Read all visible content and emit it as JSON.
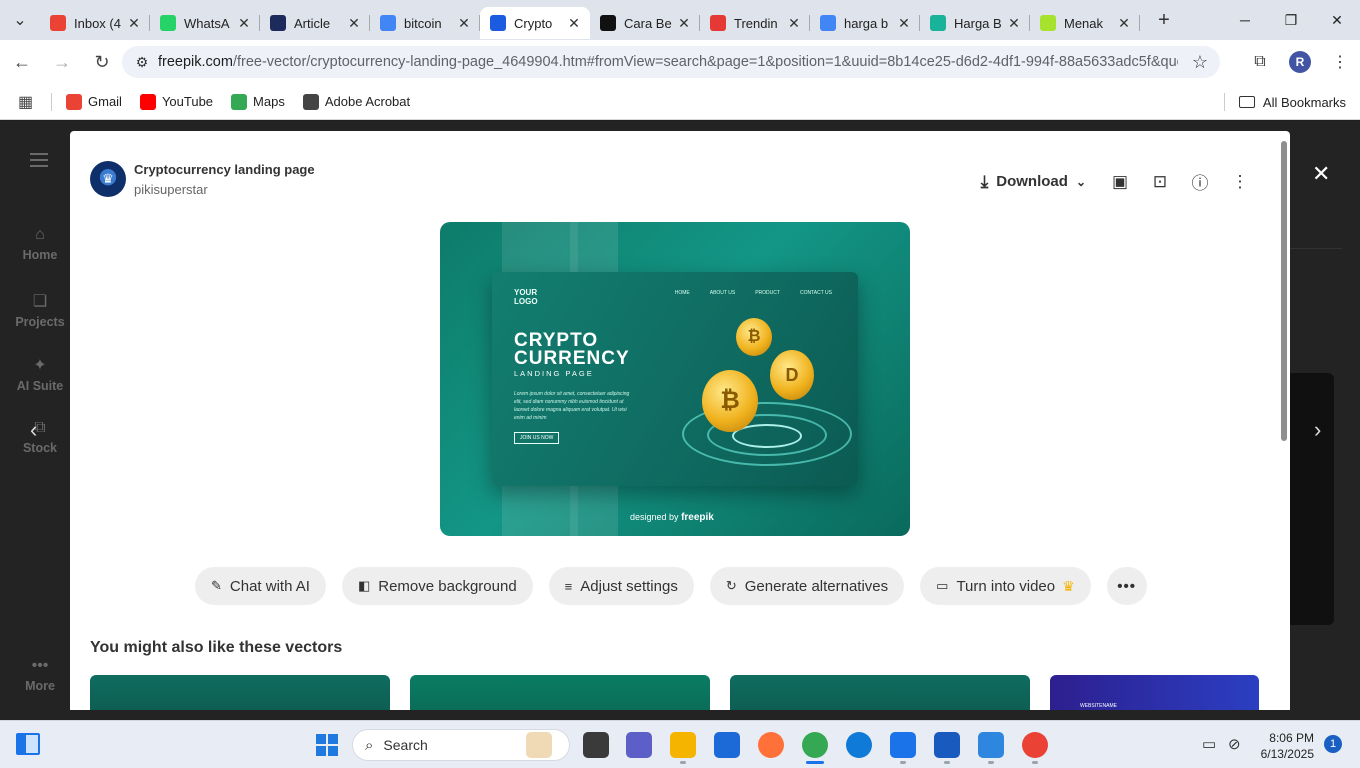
{
  "tabs": [
    {
      "label": "Inbox (4",
      "icon": "gmail-icon",
      "color": "#ea4335",
      "active": false
    },
    {
      "label": "WhatsA",
      "icon": "whatsapp-icon",
      "color": "#25d366",
      "active": false
    },
    {
      "label": "Article",
      "icon": "ro-icon",
      "color": "#1d2b5c",
      "active": false
    },
    {
      "label": "bitcoin",
      "icon": "google-icon",
      "color": "#4285f4",
      "active": false
    },
    {
      "label": "Crypto",
      "icon": "freepik-icon",
      "color": "#1a5be0",
      "active": true
    },
    {
      "label": "Cara Be",
      "icon": "k-icon",
      "color": "#111111",
      "active": false
    },
    {
      "label": "Trendin",
      "icon": "trend-icon",
      "color": "#e53935",
      "active": false
    },
    {
      "label": "harga b",
      "icon": "google-icon",
      "color": "#4285f4",
      "active": false
    },
    {
      "label": "Harga B",
      "icon": "n-icon",
      "color": "#19b39a",
      "active": false
    },
    {
      "label": "Menak",
      "icon": "menak-icon",
      "color": "#a6e22e",
      "active": false
    }
  ],
  "address": {
    "domain": "freepik.com",
    "path": "/free-vector/cryptocurrency-landing-page_4649904.htm#fromView=search&page=1&position=1&uuid=8b14ce25-d6d2-4df1-994f-88a5633adc5f&que..."
  },
  "profile_initial": "R",
  "bookmarks": [
    {
      "label": "Gmail",
      "icon": "gmail-icon",
      "color": "#ea4335"
    },
    {
      "label": "YouTube",
      "icon": "youtube-icon",
      "color": "#ff0000"
    },
    {
      "label": "Maps",
      "icon": "maps-icon",
      "color": "#34a853"
    },
    {
      "label": "Adobe Acrobat",
      "icon": "acrobat-icon",
      "color": "#444444"
    }
  ],
  "all_bookmarks": "All Bookmarks",
  "leftnav": [
    {
      "label": "Home",
      "icon": "home-icon"
    },
    {
      "label": "Projects",
      "icon": "projects-icon"
    },
    {
      "label": "AI Suite",
      "icon": "sparkle-icon"
    },
    {
      "label": "Stock",
      "icon": "stock-icon"
    },
    {
      "label": "More",
      "icon": "more-dots-icon"
    }
  ],
  "modal": {
    "title": "Cryptocurrency landing page",
    "author": "pikisuperstar",
    "download_label": "Download",
    "preview": {
      "logo_line1": "YOUR",
      "logo_line2": "LOGO",
      "nav": [
        "HOME",
        "ABOUT US",
        "PRODUCT",
        "CONTACT US"
      ],
      "heading1": "CRYPTO",
      "heading2": "CURRENCY",
      "subheading": "LANDING PAGE",
      "body": "Lorem ipsum dolor sit amet, consectetuer adipiscing elit, sed diam nonummy nibh euismod tincidunt ut laoreet dolore magna aliquam erat volutpat. Ut wisi enim ad minim",
      "button": "JOIN US NOW",
      "credit_prefix": "designed by",
      "credit_brand": "freepik"
    },
    "tools": [
      {
        "label": "Chat with AI",
        "icon": "chat-ai-icon"
      },
      {
        "label": "Remove background",
        "icon": "remove-bg-icon"
      },
      {
        "label": "Adjust settings",
        "icon": "sliders-icon"
      },
      {
        "label": "Generate alternatives",
        "icon": "refresh-icon"
      },
      {
        "label": "Turn into video",
        "icon": "video-icon",
        "premium": true
      }
    ],
    "related_title": "You might also like these vectors",
    "related_thumb4_text": "WEBSITENAME"
  },
  "taskbar": {
    "search_label": "Search",
    "time": "8:06 PM",
    "date": "6/13/2025",
    "notifications": "1"
  }
}
